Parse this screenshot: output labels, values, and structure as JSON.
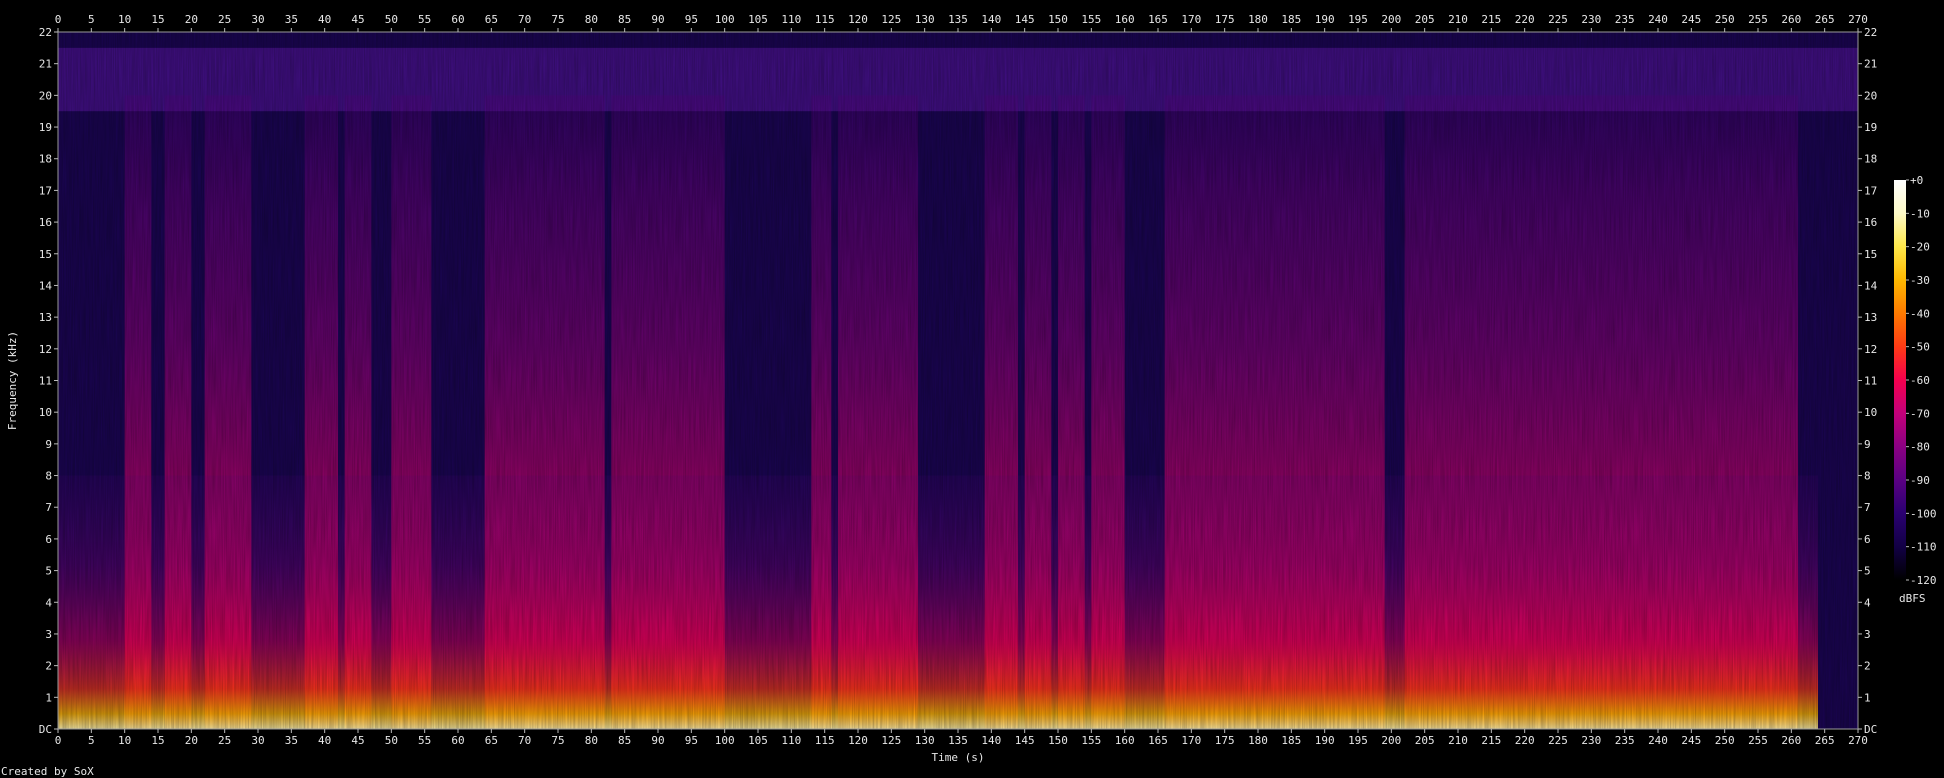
{
  "chart_data": {
    "type": "heatmap",
    "title": "",
    "xlabel": "Time (s)",
    "ylabel": "Frequency (kHz)",
    "xlim": [
      0,
      270
    ],
    "ylim": [
      0,
      22
    ],
    "x_ticks": [
      0,
      5,
      10,
      15,
      20,
      25,
      30,
      35,
      40,
      45,
      50,
      55,
      60,
      65,
      70,
      75,
      80,
      85,
      90,
      95,
      100,
      105,
      110,
      115,
      120,
      125,
      130,
      135,
      140,
      145,
      150,
      155,
      160,
      165,
      170,
      175,
      180,
      185,
      190,
      195,
      200,
      205,
      210,
      215,
      220,
      225,
      230,
      235,
      240,
      245,
      250,
      255,
      260,
      265,
      270
    ],
    "y_ticks": [
      "DC",
      "1",
      "2",
      "3",
      "4",
      "5",
      "6",
      "7",
      "8",
      "9",
      "10",
      "11",
      "12",
      "13",
      "14",
      "15",
      "16",
      "17",
      "18",
      "19",
      "20",
      "21",
      "22"
    ],
    "colorbar": {
      "unit": "dBFS",
      "range": [
        -120,
        0
      ],
      "ticks": [
        "+0",
        "-10",
        "-20",
        "-30",
        "-40",
        "-50",
        "-60",
        "-70",
        "-80",
        "-90",
        "-100",
        "-110",
        "-120"
      ],
      "colors": [
        "#000000",
        "#120045",
        "#2a0071",
        "#5a0083",
        "#8b0082",
        "#c3007a",
        "#f5004e",
        "#ff3a15",
        "#ff7a00",
        "#ffb800",
        "#ffe84a",
        "#fffbc8",
        "#ffffff"
      ]
    },
    "loud_segments": [
      [
        10,
        14
      ],
      [
        16,
        20
      ],
      [
        22,
        29
      ],
      [
        37,
        42
      ],
      [
        43,
        47
      ],
      [
        50,
        56
      ],
      [
        64,
        82
      ],
      [
        83,
        100
      ],
      [
        113,
        116
      ],
      [
        117,
        121
      ],
      [
        121,
        129
      ],
      [
        139,
        144
      ],
      [
        145,
        149
      ],
      [
        150,
        154
      ],
      [
        155,
        160
      ],
      [
        166,
        184
      ],
      [
        184,
        199
      ],
      [
        202,
        241
      ],
      [
        241,
        261
      ]
    ],
    "background_band_khz": [
      19.5,
      21.5
    ],
    "credit": "Created by SoX"
  }
}
